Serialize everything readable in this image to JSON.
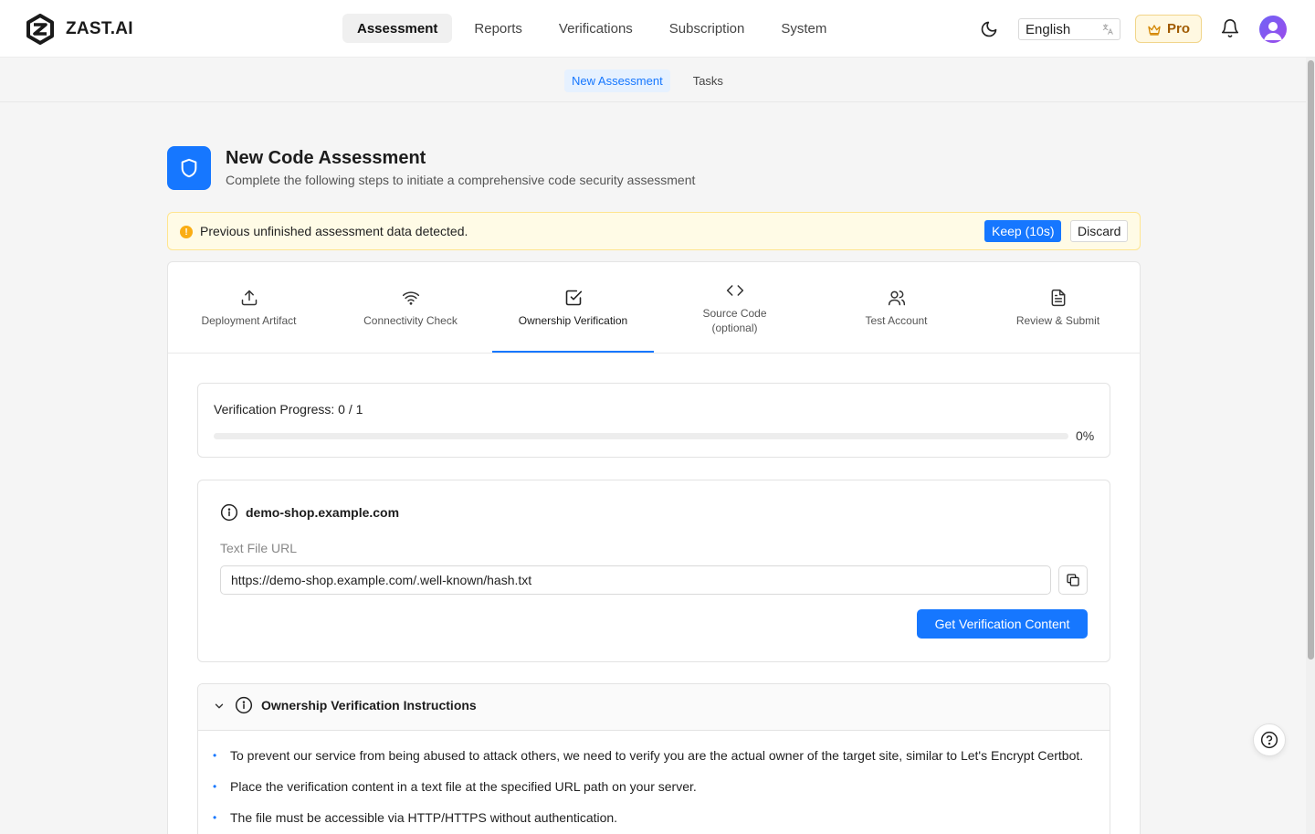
{
  "app": {
    "brand": "ZAST.AI"
  },
  "mainnav": [
    {
      "label": "Assessment",
      "active": true
    },
    {
      "label": "Reports"
    },
    {
      "label": "Verifications"
    },
    {
      "label": "Subscription"
    },
    {
      "label": "System"
    }
  ],
  "header_tools": {
    "language": "English",
    "plan": "Pro"
  },
  "subnav": [
    {
      "label": "New Assessment",
      "active": true
    },
    {
      "label": "Tasks"
    }
  ],
  "page": {
    "title": "New Code Assessment",
    "subtitle": "Complete the following steps to initiate a comprehensive code security assessment"
  },
  "alert": {
    "message": "Previous unfinished assessment data detected.",
    "keep_label": "Keep (10s)",
    "discard_label": "Discard"
  },
  "steps": [
    {
      "label": "Deployment Artifact",
      "icon": "upload-icon"
    },
    {
      "label": "Connectivity Check",
      "icon": "wifi-icon"
    },
    {
      "label": "Ownership Verification",
      "icon": "check-square-icon",
      "active": true
    },
    {
      "label": "Source Code\n(optional)",
      "icon": "code-icon"
    },
    {
      "label": "Test Account",
      "icon": "users-icon"
    },
    {
      "label": "Review & Submit",
      "icon": "document-icon"
    }
  ],
  "progress": {
    "label": "Verification Progress: 0 / 1",
    "percent_text": "0%",
    "fraction": 0
  },
  "domain": {
    "name": "demo-shop.example.com",
    "field_label": "Text File URL",
    "url_value": "https://demo-shop.example.com/.well-known/hash.txt",
    "button_label": "Get Verification Content"
  },
  "instructions": {
    "title": "Ownership Verification Instructions",
    "items": [
      "To prevent our service from being abused to attack others, we need to verify you are the actual owner of the target site, similar to Let's Encrypt Certbot.",
      "Place the verification content in a text file at the specified URL path on your server.",
      "The file must be accessible via HTTP/HTTPS without authentication."
    ]
  },
  "colors": {
    "accent": "#1677ff",
    "warning": "#faad14",
    "pro": "#a05a00"
  }
}
